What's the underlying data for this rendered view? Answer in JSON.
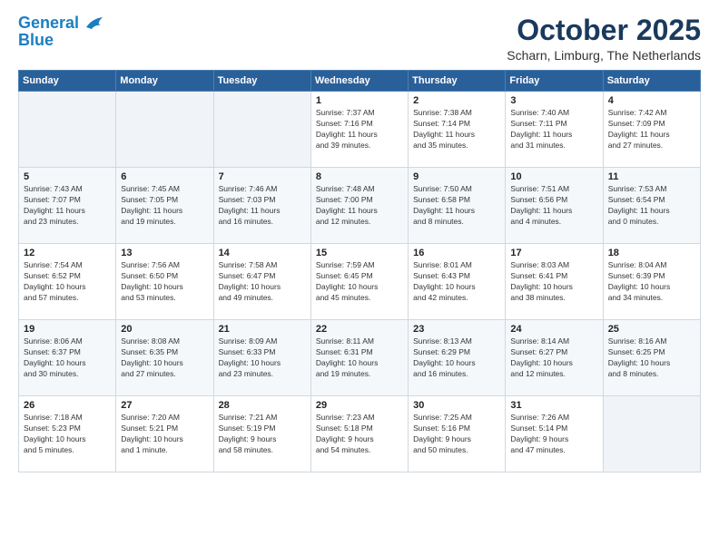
{
  "header": {
    "logo_line1": "General",
    "logo_line2": "Blue",
    "month": "October 2025",
    "location": "Scharn, Limburg, The Netherlands"
  },
  "days_of_week": [
    "Sunday",
    "Monday",
    "Tuesday",
    "Wednesday",
    "Thursday",
    "Friday",
    "Saturday"
  ],
  "weeks": [
    [
      {
        "day": "",
        "info": ""
      },
      {
        "day": "",
        "info": ""
      },
      {
        "day": "",
        "info": ""
      },
      {
        "day": "1",
        "info": "Sunrise: 7:37 AM\nSunset: 7:16 PM\nDaylight: 11 hours\nand 39 minutes."
      },
      {
        "day": "2",
        "info": "Sunrise: 7:38 AM\nSunset: 7:14 PM\nDaylight: 11 hours\nand 35 minutes."
      },
      {
        "day": "3",
        "info": "Sunrise: 7:40 AM\nSunset: 7:11 PM\nDaylight: 11 hours\nand 31 minutes."
      },
      {
        "day": "4",
        "info": "Sunrise: 7:42 AM\nSunset: 7:09 PM\nDaylight: 11 hours\nand 27 minutes."
      }
    ],
    [
      {
        "day": "5",
        "info": "Sunrise: 7:43 AM\nSunset: 7:07 PM\nDaylight: 11 hours\nand 23 minutes."
      },
      {
        "day": "6",
        "info": "Sunrise: 7:45 AM\nSunset: 7:05 PM\nDaylight: 11 hours\nand 19 minutes."
      },
      {
        "day": "7",
        "info": "Sunrise: 7:46 AM\nSunset: 7:03 PM\nDaylight: 11 hours\nand 16 minutes."
      },
      {
        "day": "8",
        "info": "Sunrise: 7:48 AM\nSunset: 7:00 PM\nDaylight: 11 hours\nand 12 minutes."
      },
      {
        "day": "9",
        "info": "Sunrise: 7:50 AM\nSunset: 6:58 PM\nDaylight: 11 hours\nand 8 minutes."
      },
      {
        "day": "10",
        "info": "Sunrise: 7:51 AM\nSunset: 6:56 PM\nDaylight: 11 hours\nand 4 minutes."
      },
      {
        "day": "11",
        "info": "Sunrise: 7:53 AM\nSunset: 6:54 PM\nDaylight: 11 hours\nand 0 minutes."
      }
    ],
    [
      {
        "day": "12",
        "info": "Sunrise: 7:54 AM\nSunset: 6:52 PM\nDaylight: 10 hours\nand 57 minutes."
      },
      {
        "day": "13",
        "info": "Sunrise: 7:56 AM\nSunset: 6:50 PM\nDaylight: 10 hours\nand 53 minutes."
      },
      {
        "day": "14",
        "info": "Sunrise: 7:58 AM\nSunset: 6:47 PM\nDaylight: 10 hours\nand 49 minutes."
      },
      {
        "day": "15",
        "info": "Sunrise: 7:59 AM\nSunset: 6:45 PM\nDaylight: 10 hours\nand 45 minutes."
      },
      {
        "day": "16",
        "info": "Sunrise: 8:01 AM\nSunset: 6:43 PM\nDaylight: 10 hours\nand 42 minutes."
      },
      {
        "day": "17",
        "info": "Sunrise: 8:03 AM\nSunset: 6:41 PM\nDaylight: 10 hours\nand 38 minutes."
      },
      {
        "day": "18",
        "info": "Sunrise: 8:04 AM\nSunset: 6:39 PM\nDaylight: 10 hours\nand 34 minutes."
      }
    ],
    [
      {
        "day": "19",
        "info": "Sunrise: 8:06 AM\nSunset: 6:37 PM\nDaylight: 10 hours\nand 30 minutes."
      },
      {
        "day": "20",
        "info": "Sunrise: 8:08 AM\nSunset: 6:35 PM\nDaylight: 10 hours\nand 27 minutes."
      },
      {
        "day": "21",
        "info": "Sunrise: 8:09 AM\nSunset: 6:33 PM\nDaylight: 10 hours\nand 23 minutes."
      },
      {
        "day": "22",
        "info": "Sunrise: 8:11 AM\nSunset: 6:31 PM\nDaylight: 10 hours\nand 19 minutes."
      },
      {
        "day": "23",
        "info": "Sunrise: 8:13 AM\nSunset: 6:29 PM\nDaylight: 10 hours\nand 16 minutes."
      },
      {
        "day": "24",
        "info": "Sunrise: 8:14 AM\nSunset: 6:27 PM\nDaylight: 10 hours\nand 12 minutes."
      },
      {
        "day": "25",
        "info": "Sunrise: 8:16 AM\nSunset: 6:25 PM\nDaylight: 10 hours\nand 8 minutes."
      }
    ],
    [
      {
        "day": "26",
        "info": "Sunrise: 7:18 AM\nSunset: 5:23 PM\nDaylight: 10 hours\nand 5 minutes."
      },
      {
        "day": "27",
        "info": "Sunrise: 7:20 AM\nSunset: 5:21 PM\nDaylight: 10 hours\nand 1 minute."
      },
      {
        "day": "28",
        "info": "Sunrise: 7:21 AM\nSunset: 5:19 PM\nDaylight: 9 hours\nand 58 minutes."
      },
      {
        "day": "29",
        "info": "Sunrise: 7:23 AM\nSunset: 5:18 PM\nDaylight: 9 hours\nand 54 minutes."
      },
      {
        "day": "30",
        "info": "Sunrise: 7:25 AM\nSunset: 5:16 PM\nDaylight: 9 hours\nand 50 minutes."
      },
      {
        "day": "31",
        "info": "Sunrise: 7:26 AM\nSunset: 5:14 PM\nDaylight: 9 hours\nand 47 minutes."
      },
      {
        "day": "",
        "info": ""
      }
    ]
  ]
}
